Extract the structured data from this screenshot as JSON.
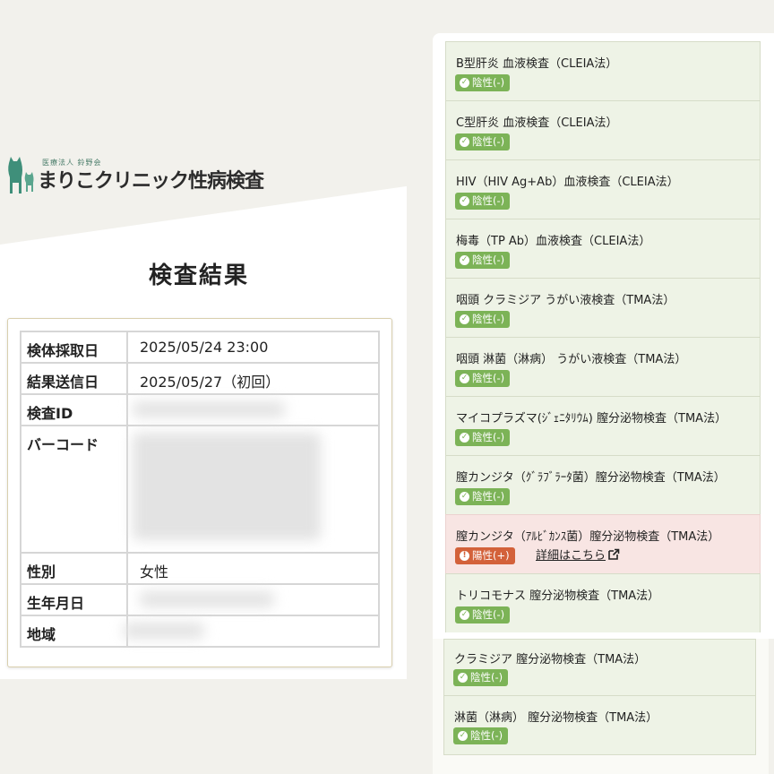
{
  "clinic": {
    "corp": "医療法人 鈴野会",
    "name": "まりこクリニック性病検査"
  },
  "page_title": "検査結果",
  "info": [
    {
      "key": "検体採取日",
      "value": "2025/05/24 23:00"
    },
    {
      "key": "結果送信日",
      "value": "2025/05/27（初回）"
    },
    {
      "key": "検査ID",
      "value": ""
    },
    {
      "key": "バーコード",
      "value": ""
    },
    {
      "key": "性別",
      "value": "女性"
    },
    {
      "key": "生年月日",
      "value": ""
    },
    {
      "key": "地域",
      "value": ""
    }
  ],
  "results": [
    {
      "name": "B型肝炎 血液検査（CLEIA法）",
      "badge": "陰性(-)",
      "positive": false
    },
    {
      "name": "C型肝炎 血液検査（CLEIA法）",
      "badge": "陰性(-)",
      "positive": false
    },
    {
      "name": "HIV（HIV Ag+Ab）血液検査（CLEIA法）",
      "badge": "陰性(-)",
      "positive": false
    },
    {
      "name": "梅毒（TP Ab）血液検査（CLEIA法）",
      "badge": "陰性(-)",
      "positive": false
    },
    {
      "name": "咽頭 クラミジア うがい液検査（TMA法）",
      "badge": "陰性(-)",
      "positive": false
    },
    {
      "name": "咽頭 淋菌（淋病） うがい液検査（TMA法）",
      "badge": "陰性(-)",
      "positive": false
    },
    {
      "name": "マイコプラズマ(ｼﾞｪﾆﾀﾘｳﾑ) 膣分泌物検査（TMA法）",
      "badge": "陰性(-)",
      "positive": false
    },
    {
      "name": "膣カンジタ（ｸﾞﾗﾌﾞﾗｰﾀ菌）膣分泌物検査（TMA法）",
      "badge": "陰性(-)",
      "positive": false
    },
    {
      "name": "膣カンジタ（ｱﾙﾋﾞｶﾝｽ菌）膣分泌物検査（TMA法）",
      "badge": "陽性(+)",
      "positive": true,
      "link": "詳細はこちら"
    },
    {
      "name": "トリコモナス 膣分泌物検査（TMA法）",
      "badge": "陰性(-)",
      "positive": false
    }
  ],
  "results_lower": [
    {
      "name": "クラミジア 膣分泌物検査（TMA法）",
      "badge": "陰性(-)",
      "positive": false
    },
    {
      "name": "淋菌（淋病） 膣分泌物検査（TMA法）",
      "badge": "陰性(-)",
      "positive": false
    }
  ],
  "icons": {
    "negative": "check-circle-icon",
    "positive": "exclamation-circle-icon",
    "link": "external-link-icon",
    "logo": "cat-logo-icon"
  },
  "colors": {
    "negative_badge": "#7cb357",
    "positive_badge": "#d3613a",
    "item_bg": "#eef3e6",
    "positive_item_bg": "#f8e5e3"
  }
}
